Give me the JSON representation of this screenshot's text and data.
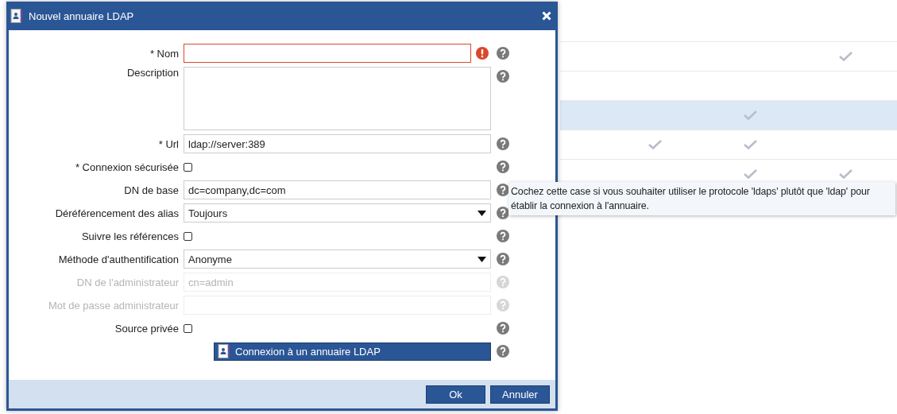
{
  "background_table": {
    "rows": [
      {
        "selected": false,
        "checks": [
          false,
          false,
          true
        ]
      },
      {
        "selected": false,
        "checks": [
          false,
          false,
          false
        ]
      },
      {
        "selected": true,
        "checks": [
          false,
          true,
          false
        ]
      },
      {
        "selected": false,
        "checks": [
          true,
          true,
          false
        ]
      },
      {
        "selected": false,
        "checks": [
          false,
          true,
          true
        ]
      }
    ]
  },
  "dialog": {
    "title": "Nouvel annuaire LDAP",
    "fields": [
      {
        "kind": "text",
        "label": "* Nom",
        "error": true,
        "disabled": false
      },
      {
        "kind": "textarea",
        "label": "Description",
        "error": false,
        "disabled": false
      },
      {
        "kind": "text",
        "label": "* Url",
        "value": "ldap://server:389",
        "error": false,
        "disabled": false
      },
      {
        "kind": "checkbox",
        "label": "* Connexion sécurisée",
        "checked": false,
        "disabled": false
      },
      {
        "kind": "text",
        "label": "DN de base",
        "value": "dc=company,dc=com",
        "error": false,
        "disabled": false
      },
      {
        "kind": "select",
        "label": "Déréférencement des alias",
        "value": "Toujours",
        "disabled": false
      },
      {
        "kind": "checkbox",
        "label": "Suivre les références",
        "checked": false,
        "disabled": false
      },
      {
        "kind": "select",
        "label": "Méthode d'authentification",
        "value": "Anonyme",
        "disabled": false
      },
      {
        "kind": "text",
        "label": "DN de l'administrateur",
        "placeholder": "cn=admin",
        "error": false,
        "disabled": true
      },
      {
        "kind": "text",
        "label": "Mot de passe administrateur",
        "error": false,
        "disabled": true
      },
      {
        "kind": "checkbox",
        "label": "Source privée",
        "checked": false,
        "disabled": false
      },
      {
        "kind": "button",
        "label": "Connexion à un annuaire LDAP",
        "disabled": false
      }
    ],
    "buttons": [
      "Ok",
      "Annuler"
    ]
  },
  "tooltip": {
    "text": "Cochez cette case si vous souhaiter utiliser le protocole 'ldaps' plutôt que 'ldap' pour établir la connexion à l'annuaire."
  }
}
